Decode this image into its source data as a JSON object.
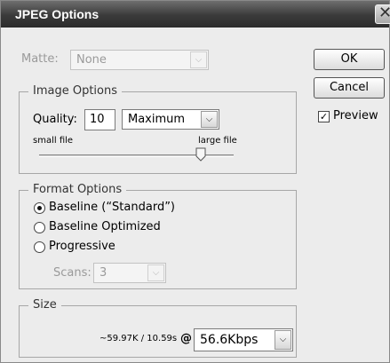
{
  "window": {
    "title": "JPEG Options",
    "close_glyph": "✕"
  },
  "matte": {
    "label": "Matte:",
    "value": "None"
  },
  "buttons": {
    "ok": "OK",
    "cancel": "Cancel"
  },
  "preview": {
    "label": "Preview",
    "checked": true,
    "check_glyph": "✓"
  },
  "image_options": {
    "legend": "Image Options",
    "quality_label": "Quality:",
    "quality_value": "10",
    "quality_preset": "Maximum",
    "slider_min_label": "small file",
    "slider_max_label": "large file",
    "slider_level_fraction": 0.83
  },
  "format_options": {
    "legend": "Format Options",
    "choices": [
      {
        "label": "Baseline (“Standard”)",
        "selected": true
      },
      {
        "label": "Baseline Optimized",
        "selected": false
      },
      {
        "label": "Progressive",
        "selected": false
      }
    ],
    "scans_label": "Scans:",
    "scans_value": "3"
  },
  "size": {
    "legend": "Size",
    "estimate": "~59.97K / 10.59s",
    "at_symbol": "@",
    "connection": "56.6Kbps"
  },
  "icons": {
    "dropdown_arrow": "⌵"
  }
}
